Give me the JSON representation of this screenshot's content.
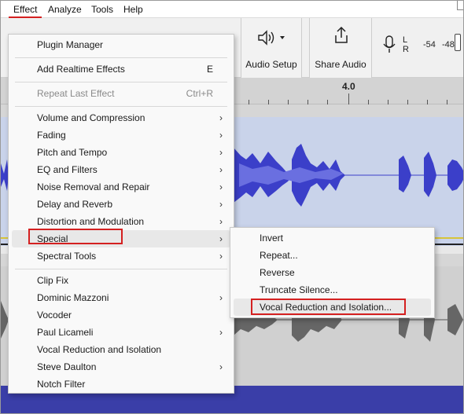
{
  "menubar": {
    "items": [
      "Effect",
      "Analyze",
      "Tools",
      "Help"
    ]
  },
  "toolbar": {
    "audio_setup_label": "Audio Setup",
    "share_audio_label": "Share Audio",
    "meter_l": "L",
    "meter_r": "R",
    "meter_values": [
      "-54",
      "-48"
    ]
  },
  "timeline": {
    "marker": "4.0"
  },
  "effect_menu": {
    "items": [
      {
        "label": "Plugin Manager"
      },
      {
        "label": "Add Realtime Effects",
        "shortcut": "E"
      },
      {
        "label": "Repeat Last Effect",
        "shortcut": "Ctrl+R",
        "disabled": true
      },
      {
        "label": "Volume and Compression",
        "submenu": true
      },
      {
        "label": "Fading",
        "submenu": true
      },
      {
        "label": "Pitch and Tempo",
        "submenu": true
      },
      {
        "label": "EQ and Filters",
        "submenu": true
      },
      {
        "label": "Noise Removal and Repair",
        "submenu": true
      },
      {
        "label": "Delay and Reverb",
        "submenu": true
      },
      {
        "label": "Distortion and Modulation",
        "submenu": true
      },
      {
        "label": "Special",
        "submenu": true,
        "highlighted": true
      },
      {
        "label": "Spectral Tools",
        "submenu": true
      },
      {
        "label": "Clip Fix"
      },
      {
        "label": "Dominic Mazzoni",
        "submenu": true
      },
      {
        "label": "Vocoder"
      },
      {
        "label": "Paul Licameli",
        "submenu": true
      },
      {
        "label": "Vocal Reduction and Isolation"
      },
      {
        "label": "Steve Daulton",
        "submenu": true
      },
      {
        "label": "Notch Filter"
      }
    ]
  },
  "special_submenu": {
    "items": [
      {
        "label": "Invert"
      },
      {
        "label": "Repeat..."
      },
      {
        "label": "Reverse"
      },
      {
        "label": "Truncate Silence..."
      },
      {
        "label": "Vocal Reduction and Isolation...",
        "highlighted": true
      }
    ]
  },
  "colors": {
    "waveform": "#3b3fc9",
    "waveform_light": "#6a6fe0",
    "track_bg": "#c9d3ea",
    "highlight_box": "#d42020"
  }
}
